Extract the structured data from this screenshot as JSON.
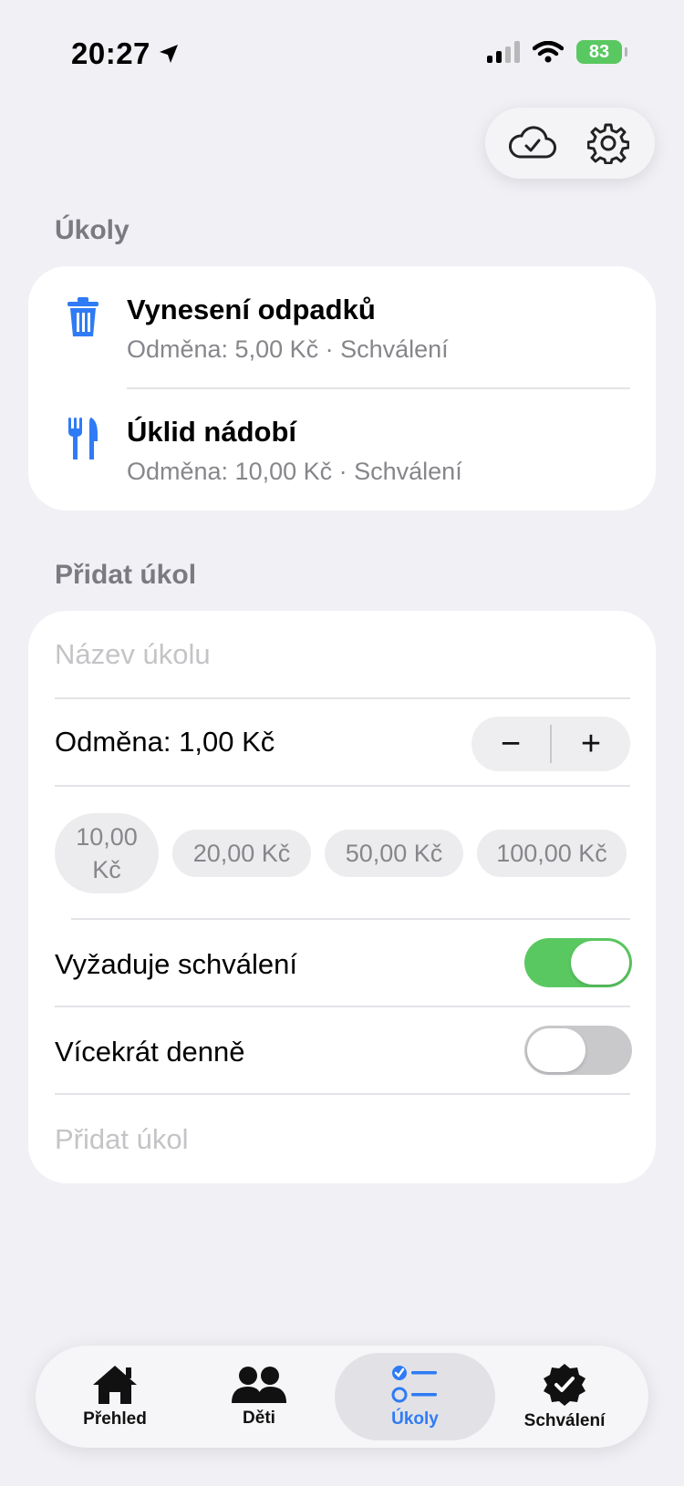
{
  "status_bar": {
    "time": "20:27",
    "battery": "83"
  },
  "sections": {
    "tasks_title": "Úkoly",
    "add_title": "Přidat úkol"
  },
  "tasks": [
    {
      "icon": "trash-icon",
      "title": "Vynesení odpadků",
      "subtitle": "Odměna: 5,00 Kč · Schválení"
    },
    {
      "icon": "fork-knife-icon",
      "title": "Úklid nádobí",
      "subtitle": "Odměna: 10,00 Kč · Schválení"
    }
  ],
  "form": {
    "name_placeholder": "Název úkolu",
    "reward_label": "Odměna: 1,00 Kč",
    "stepper_minus": "−",
    "stepper_plus": "+",
    "chips": [
      "10,00 Kč",
      "20,00 Kč",
      "50,00 Kč",
      "100,00 Kč"
    ],
    "requires_approval_label": "Vyžaduje schválení",
    "requires_approval_on": true,
    "multiple_daily_label": "Vícekrát denně",
    "multiple_daily_on": false,
    "add_button_label": "Přidat úkol"
  },
  "colors": {
    "accent": "#2F7BF5",
    "toggle_on": "#5AC861",
    "toggle_off": "#C9C9CC"
  },
  "tabbar": {
    "tabs": [
      {
        "label": "Přehled",
        "icon": "house-icon"
      },
      {
        "label": "Děti",
        "icon": "people-icon"
      },
      {
        "label": "Úkoly",
        "icon": "checklist-icon",
        "active": true
      },
      {
        "label": "Schválení",
        "icon": "approval-badge-icon"
      }
    ]
  }
}
